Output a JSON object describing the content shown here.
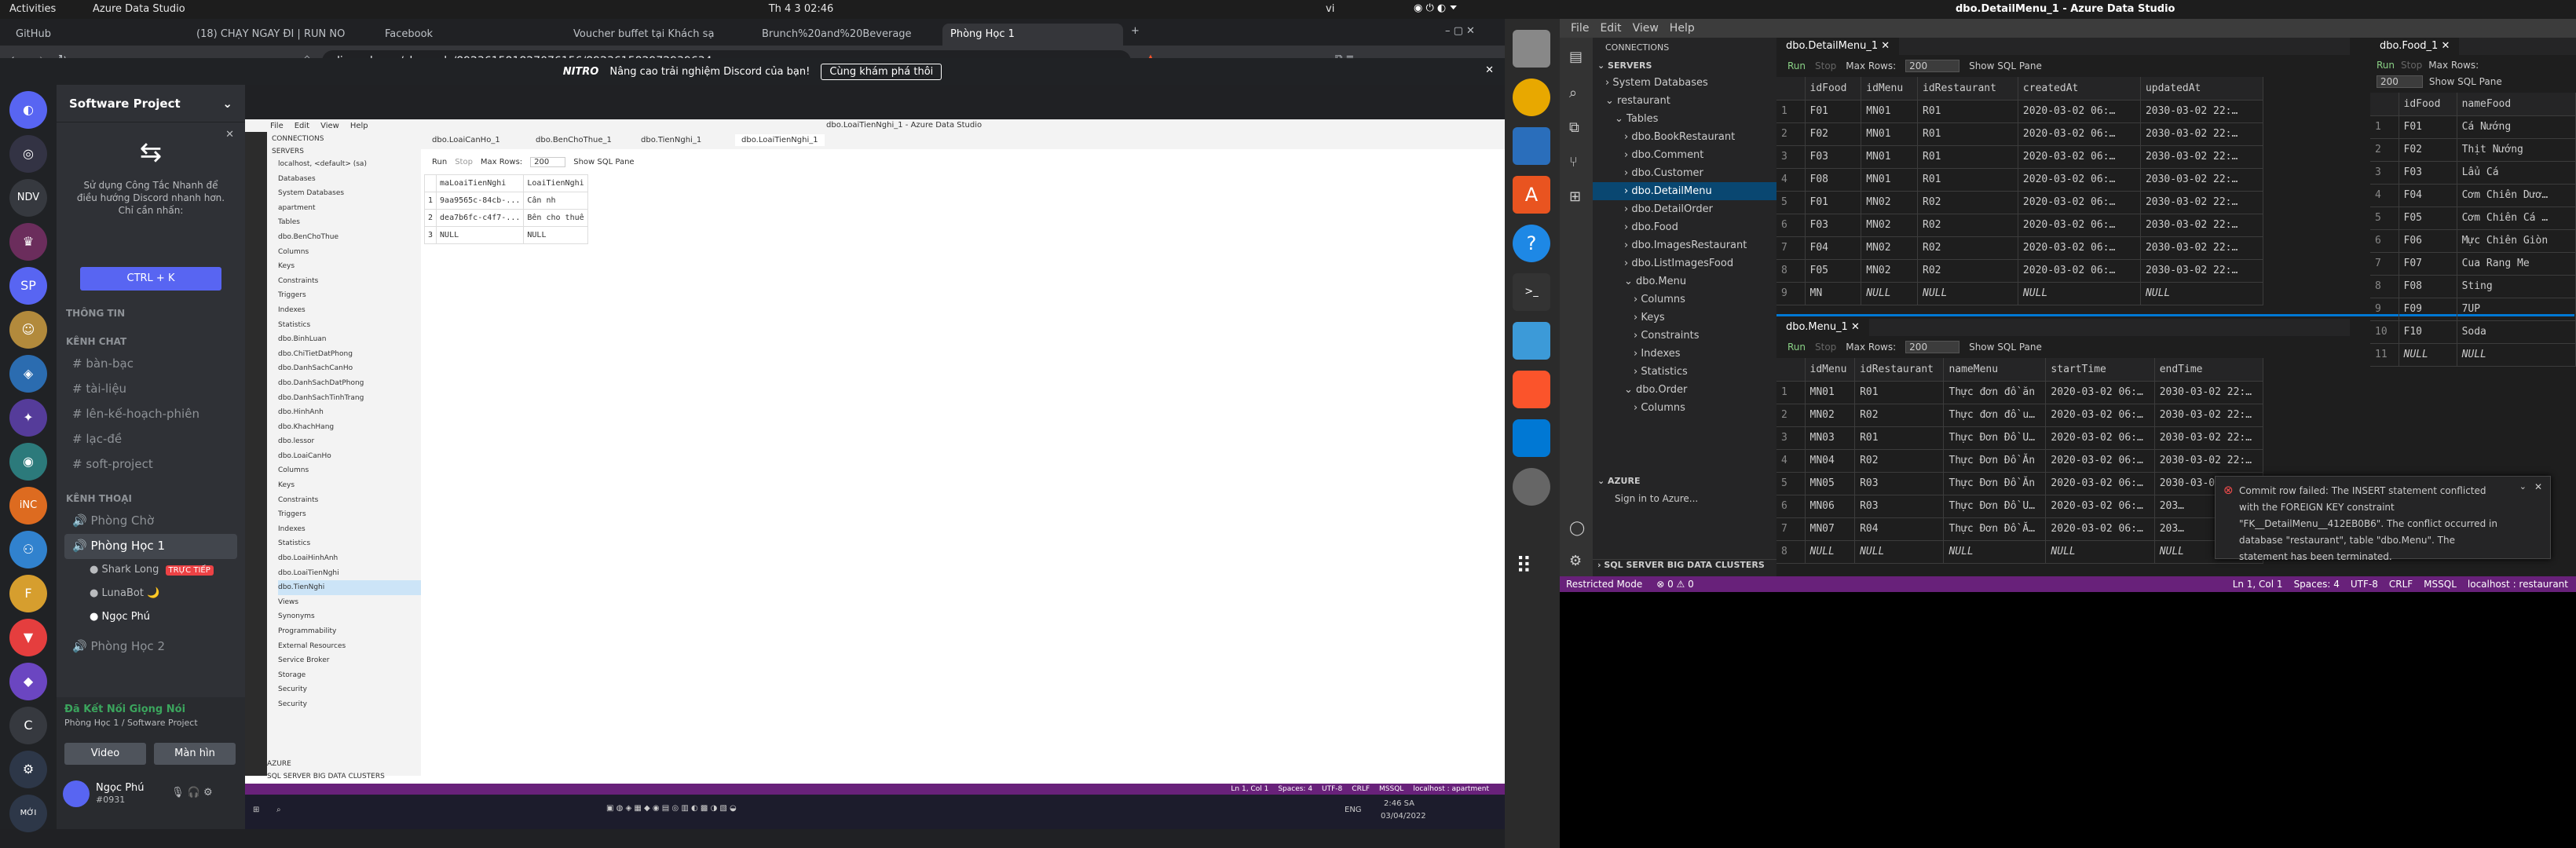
{
  "topbar": {
    "activities": "Activities",
    "app": "Azure Data Studio",
    "clock": "Th 4 3  02:46",
    "lang": "vi",
    "title": "dbo.DetailMenu_1 - Azure Data Studio"
  },
  "browser": {
    "tabs": [
      "GitHub",
      "(18) CHẠY NGAY ĐI | RUN NO",
      "Facebook",
      "Voucher buffet tại Khách sạ",
      "Brunch%20and%20Beverage",
      "Phòng Học 1"
    ],
    "url": "discord.com/channels/892361581827076156/892361582972939634"
  },
  "discord": {
    "nitro_brand": "NITRO",
    "nitro_text": "Nâng cao trải nghiệm Discord của bạn!",
    "nitro_button": "Cùng khám phá thôi",
    "server_name": "Software Project",
    "hint_text": "Sử dụng Công Tắc Nhanh để điều hướng Discord nhanh hơn. Chỉ cần nhấn:",
    "hint_button": "CTRL + K",
    "servers": [
      "NDV",
      "SP",
      "iNC",
      "C",
      "MỚI"
    ],
    "cat_info": "THÔNG TIN",
    "cat_chat": "KÊNH CHAT",
    "cat_voice": "KÊNH THOẠI",
    "text_channels": [
      "bàn-bạc",
      "tài-liệu",
      "lên-kế-hoạch-phiên",
      "lạc-đề",
      "soft-project"
    ],
    "voice_channels": [
      "Phòng Chờ",
      "Phòng Học 1",
      "Phòng Học 2"
    ],
    "voice_users": [
      "Shark Long",
      "LunaBot 🌙",
      "Ngọc Phú"
    ],
    "live_badge": "TRỰC TIẾP",
    "voice_status": "Đã Kết Nối Giọng Nói",
    "voice_sub": "Phòng Học 1 / Software Project",
    "video": "Video",
    "screen": "Màn hìn",
    "user_name": "Ngọc Phú",
    "user_tag": "#0931"
  },
  "inner": {
    "menu": [
      "File",
      "Edit",
      "View",
      "Help"
    ],
    "title": "dbo.LoaiTienNghi_1 - Azure Data Studio",
    "tabs": [
      "dbo.LoaiCanHo_1",
      "dbo.BenChoThue_1",
      "dbo.TienNghi_1",
      "dbo.LoaiTienNghi_1"
    ],
    "connections": "CONNECTIONS",
    "servers": "SERVERS",
    "tree": [
      "localhost, <default> (sa)",
      "Databases",
      "System Databases",
      "apartment",
      "Tables",
      "dbo.BenChoThue",
      "Columns",
      "Keys",
      "Constraints",
      "Triggers",
      "Indexes",
      "Statistics",
      "dbo.BinhLuan",
      "dbo.ChiTietDatPhong",
      "dbo.DanhSachCanHo",
      "dbo.DanhSachDatPhong",
      "dbo.DanhSachTinhTrang",
      "dbo.HinhAnh",
      "dbo.KhachHang",
      "dbo.lessor",
      "dbo.LoaiCanHo",
      "Columns",
      "Keys",
      "Constraints",
      "Triggers",
      "Indexes",
      "Statistics",
      "dbo.LoaiHinhAnh",
      "dbo.LoaiTienNghi",
      "dbo.TienNghi",
      "Views",
      "Synonyms",
      "Programmability",
      "External Resources",
      "Service Broker",
      "Storage",
      "Security",
      "Security"
    ],
    "azure": "AZURE",
    "bigdata": "SQL SERVER BIG DATA CLUSTERS",
    "run": "Run",
    "stop": "Stop",
    "maxrows_label": "Max Rows:",
    "maxrows": "200",
    "show_sql": "Show SQL Pane",
    "grid_headers": [
      "maLoaiTienNghi",
      "LoaiTienNghi"
    ],
    "grid_rows": [
      [
        "1",
        "9aa9565c-84cb-...",
        "Cân nh"
      ],
      [
        "2",
        "dea7b6fc-c4f7-...",
        "Bên cho thuê"
      ],
      [
        "3",
        "NULL",
        "NULL"
      ]
    ],
    "status": [
      "Ln 1, Col 1",
      "Spaces: 4",
      "UTF-8",
      "CRLF",
      "MSSQL",
      "localhost : apartment"
    ],
    "taskbar_time": "2:46 SA",
    "taskbar_date": "03/04/2022",
    "taskbar_lang": "ENG"
  },
  "ads": {
    "menu": [
      "File",
      "Edit",
      "View",
      "Help"
    ],
    "connections": "CONNECTIONS",
    "servers": "SERVERS",
    "tree": [
      "System Databases",
      "restaurant",
      "Tables",
      "dbo.BookRestaurant",
      "dbo.Comment",
      "dbo.Customer",
      "dbo.DetailMenu",
      "dbo.DetailOrder",
      "dbo.Food",
      "dbo.ImagesRestaurant",
      "dbo.ListImagesFood",
      "dbo.Menu",
      "Columns",
      "Keys",
      "Constraints",
      "Indexes",
      "Statistics",
      "dbo.Order",
      "Columns"
    ],
    "azure": "AZURE",
    "azure_signin": "Sign in to Azure...",
    "bigdata": "SQL SERVER BIG DATA CLUSTERS",
    "tab1": "dbo.DetailMenu_1",
    "tab2": "dbo.Food_1",
    "tab3": "dbo.Menu_1",
    "run": "Run",
    "stop": "Stop",
    "maxrows_label": "Max Rows:",
    "maxrows": "200",
    "show_sql": "Show SQL Pane",
    "dm_headers": [
      "idFood",
      "idMenu",
      "idRestaurant",
      "createdAt",
      "updatedAt"
    ],
    "dm_rows": [
      [
        "1",
        "F01",
        "MN01",
        "R01",
        "2020-03-02 06:…",
        "2030-03-02 22:…"
      ],
      [
        "2",
        "F02",
        "MN01",
        "R01",
        "2020-03-02 06:…",
        "2030-03-02 22:…"
      ],
      [
        "3",
        "F03",
        "MN01",
        "R01",
        "2020-03-02 06:…",
        "2030-03-02 22:…"
      ],
      [
        "4",
        "F08",
        "MN01",
        "R01",
        "2020-03-02 06:…",
        "2030-03-02 22:…"
      ],
      [
        "5",
        "F01",
        "MN02",
        "R02",
        "2020-03-02 06:…",
        "2030-03-02 22:…"
      ],
      [
        "6",
        "F03",
        "MN02",
        "R02",
        "2020-03-02 06:…",
        "2030-03-02 22:…"
      ],
      [
        "7",
        "F04",
        "MN02",
        "R02",
        "2020-03-02 06:…",
        "2030-03-02 22:…"
      ],
      [
        "8",
        "F05",
        "MN02",
        "R02",
        "2020-03-02 06:…",
        "2030-03-02 22:…"
      ],
      [
        "9",
        "MN",
        "NULL",
        "NULL",
        "NULL",
        "NULL"
      ]
    ],
    "food_headers": [
      "idFood",
      "nameFood"
    ],
    "food_rows": [
      [
        "1",
        "F01",
        "Cá Nướng"
      ],
      [
        "2",
        "F02",
        "Thịt Nướng"
      ],
      [
        "3",
        "F03",
        "Lẩu Cá"
      ],
      [
        "4",
        "F04",
        "Cơm Chiên Dươ…"
      ],
      [
        "5",
        "F05",
        "Cơm Chiên Cá …"
      ],
      [
        "6",
        "F06",
        "Mực Chiên Giòn"
      ],
      [
        "7",
        "F07",
        "Cua Rang Me"
      ],
      [
        "8",
        "F08",
        "Sting"
      ],
      [
        "9",
        "F09",
        "7UP"
      ],
      [
        "10",
        "F10",
        "Soda"
      ],
      [
        "11",
        "NULL",
        "NULL"
      ]
    ],
    "menu_headers": [
      "idMenu",
      "idRestaurant",
      "nameMenu",
      "startTime",
      "endTime"
    ],
    "menu_rows": [
      [
        "1",
        "MN01",
        "R01",
        "Thực đơn đồ ăn",
        "2020-03-02 06:…",
        "2030-03-02 22:…"
      ],
      [
        "2",
        "MN02",
        "R02",
        "Thực đơn đồ u…",
        "2020-03-02 06:…",
        "2030-03-02 22:…"
      ],
      [
        "3",
        "MN03",
        "R01",
        "Thực Đơn Đồ U…",
        "2020-03-02 06:…",
        "2030-03-02 22:…"
      ],
      [
        "4",
        "MN04",
        "R02",
        "Thực Đơn Đồ Ăn",
        "2020-03-02 06:…",
        "2030-03-02 22:…"
      ],
      [
        "5",
        "MN05",
        "R03",
        "Thực Đơn Đồ Ăn",
        "2020-03-02 06:…",
        "2030-03-02 22:…"
      ],
      [
        "6",
        "MN06",
        "R03",
        "Thực Đơn Đồ U…",
        "2020-03-02 06:…",
        "203…"
      ],
      [
        "7",
        "MN07",
        "R04",
        "Thực Đơn Đồ Ă…",
        "2020-03-02 06:…",
        "203…"
      ],
      [
        "8",
        "NULL",
        "NULL",
        "NULL",
        "NULL",
        "NULL"
      ]
    ],
    "error": "Commit row failed: The INSERT statement conflicted with the FOREIGN KEY constraint \"FK__DetailMenu__412EB0B6\". The conflict occurred in database \"restaurant\", table \"dbo.Menu\". The statement has been terminated.",
    "status_left": "Restricted Mode",
    "status_counts": "⊗ 0 ⚠ 0",
    "status": [
      "Ln 1, Col 1",
      "Spaces: 4",
      "UTF-8",
      "CRLF",
      "MSSQL",
      "localhost : restaurant"
    ]
  },
  "colors": {
    "discord_blurple": "#5865f2",
    "ads_status": "#68217a",
    "ads_selection": "#094771",
    "live_red": "#ed4245"
  }
}
